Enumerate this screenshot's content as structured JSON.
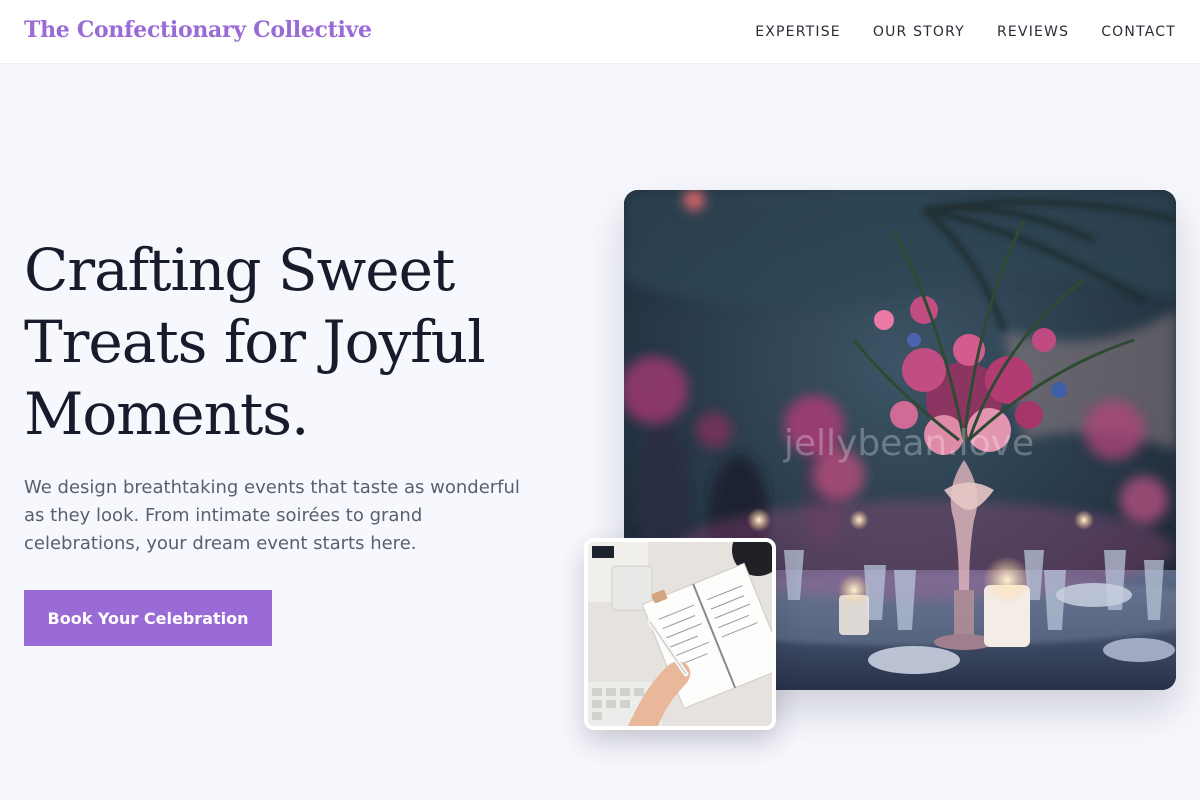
{
  "brand": {
    "name": "The Confectionary Collective"
  },
  "nav": {
    "links": [
      {
        "label": "EXPERTISE"
      },
      {
        "label": "OUR STORY"
      },
      {
        "label": "REVIEWS"
      },
      {
        "label": "CONTACT"
      }
    ]
  },
  "hero": {
    "title": "Crafting Sweet Treats for Joyful Moments.",
    "description": "We design breathtaking events that taste as wonderful as they look. From intimate soirées to grand celebrations, your dream event starts here.",
    "cta_label": "Book Your Celebration"
  },
  "images": {
    "main": {
      "watermark": "jellybean.love",
      "subject": "wedding-reception-table-with-floral-centerpiece"
    },
    "secondary": {
      "subject": "hand-writing-in-planner-notebook"
    }
  },
  "colors": {
    "accent": "#9a6ad6",
    "heading": "#171b2c",
    "body_text": "#5b5f6b",
    "page_background": "#f7f8fd",
    "nav_background": "#ffffff"
  }
}
